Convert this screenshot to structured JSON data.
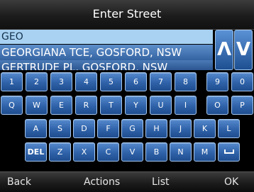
{
  "header": {
    "title": "Enter Street"
  },
  "input": {
    "value": "GEO"
  },
  "suggestions": [
    "GEORGIANA TCE, GOSFORD, NSW",
    "GERTRUDE PL, GOSFORD, NSW"
  ],
  "scroll": {
    "up_label": "Λ",
    "down_label": "V"
  },
  "keyboard": {
    "row1": [
      "1",
      "2",
      "3",
      "4",
      "5",
      "6",
      "7",
      "8",
      "9",
      "0"
    ],
    "row2": [
      "Q",
      "W",
      "E",
      "R",
      "T",
      "Y",
      "U",
      "I",
      "O",
      "P"
    ],
    "row3": [
      "A",
      "S",
      "D",
      "F",
      "G",
      "H",
      "J",
      "K",
      "L"
    ],
    "row4": [
      "DEL",
      "Z",
      "X",
      "C",
      "V",
      "B",
      "N",
      "M"
    ]
  },
  "softkeys": {
    "left": "Back",
    "actions": "Actions",
    "list": "List",
    "ok": "OK"
  },
  "colors": {
    "key_blue": "#2f62a8",
    "highlight": "#a9d2f2",
    "suggestion": "#3463a2"
  },
  "icons": {
    "space": "space-key-icon"
  }
}
